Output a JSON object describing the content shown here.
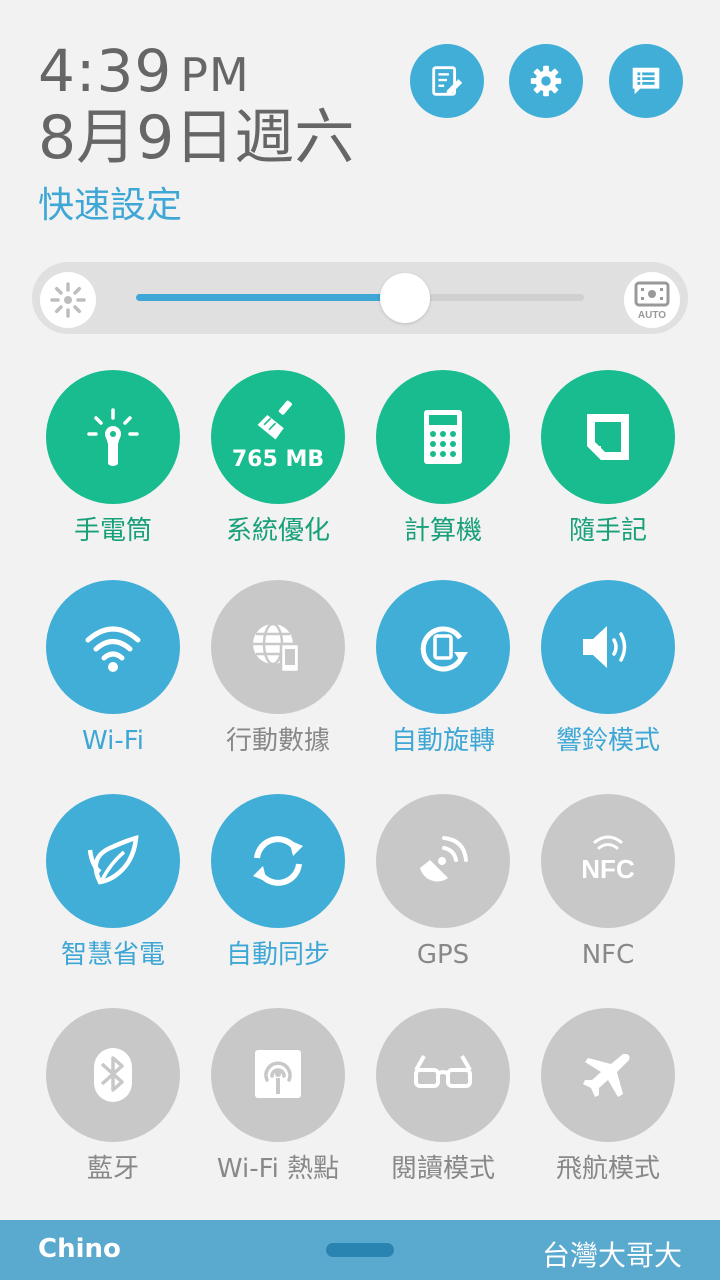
{
  "header": {
    "time": "4:39",
    "ampm": "PM",
    "date": "8月9日週六",
    "quick_settings_title": "快速設定"
  },
  "brightness": {
    "level": 0.6,
    "auto_label": "AUTO"
  },
  "tiles": [
    {
      "label": "手電筒",
      "icon": "flashlight-icon",
      "state": "green"
    },
    {
      "label": "系統優化",
      "icon": "broom-icon",
      "state": "green",
      "sub": "765 MB"
    },
    {
      "label": "計算機",
      "icon": "calculator-icon",
      "state": "green"
    },
    {
      "label": "隨手記",
      "icon": "memo-icon",
      "state": "green"
    },
    {
      "label": "Wi-Fi",
      "icon": "wifi-icon",
      "state": "blue"
    },
    {
      "label": "行動數據",
      "icon": "mobile-data-icon",
      "state": "gray"
    },
    {
      "label": "自動旋轉",
      "icon": "auto-rotate-icon",
      "state": "blue"
    },
    {
      "label": "響鈴模式",
      "icon": "speaker-icon",
      "state": "blue"
    },
    {
      "label": "智慧省電",
      "icon": "leaf-icon",
      "state": "blue"
    },
    {
      "label": "自動同步",
      "icon": "sync-icon",
      "state": "blue"
    },
    {
      "label": "GPS",
      "icon": "gps-icon",
      "state": "gray"
    },
    {
      "label": "NFC",
      "icon": "nfc-icon",
      "state": "gray"
    },
    {
      "label": "藍牙",
      "icon": "bluetooth-icon",
      "state": "gray"
    },
    {
      "label": "Wi-Fi 熱點",
      "icon": "hotspot-icon",
      "state": "gray"
    },
    {
      "label": "閱讀模式",
      "icon": "glasses-icon",
      "state": "gray"
    },
    {
      "label": "飛航模式",
      "icon": "airplane-icon",
      "state": "gray"
    }
  ],
  "footer": {
    "user": "Chino",
    "carrier": "台灣大哥大"
  },
  "colors": {
    "green": "#18bc8e",
    "blue": "#40aed7",
    "gray": "#c8c8c8"
  }
}
